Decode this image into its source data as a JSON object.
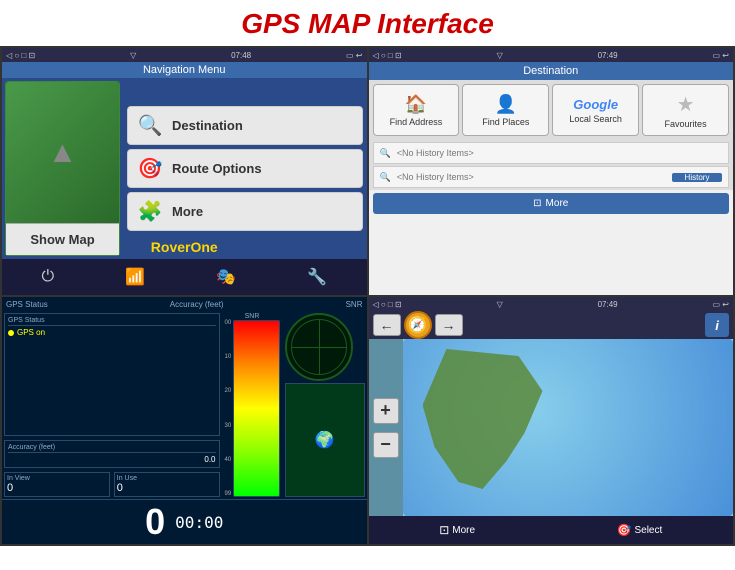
{
  "page": {
    "title": "GPS MAP Interface"
  },
  "screen1": {
    "title": "Navigation Menu",
    "status_bar": {
      "time": "07:48",
      "left_icons": "◁ ○ □ ⊡",
      "right_icons": "▽ 07:48 ▭ ↩"
    },
    "menu_items": [
      {
        "label": "Destination",
        "icon": "🔍"
      },
      {
        "label": "Route Options",
        "icon": "🎯"
      },
      {
        "label": "More",
        "icon": "🧩"
      }
    ],
    "show_map_label": "Show Map",
    "bottom_icons": [
      "⏻",
      "📶",
      "🎭",
      "🔧"
    ]
  },
  "screen2": {
    "title": "Destination",
    "status_bar": {
      "time": "07:49"
    },
    "buttons": [
      {
        "label": "Find Address",
        "icon": "🏠",
        "type": "address"
      },
      {
        "label": "Find Places",
        "icon": "👤",
        "type": "places"
      },
      {
        "label": "Local Search",
        "icon": "Google",
        "type": "google"
      },
      {
        "label": "Favourites",
        "icon": "★",
        "type": "fav"
      }
    ],
    "history_items": [
      {
        "text": "<No History Items>",
        "side": ""
      },
      {
        "text": "<No History Items>",
        "side": "History"
      }
    ],
    "more_label": "More",
    "more_icon": "⊡"
  },
  "screen3": {
    "status_bar": {
      "time": "GPS Status"
    },
    "gps_status": "GPS on",
    "accuracy_label": "Accuracy (feet)",
    "accuracy_value": "0.0",
    "snr_label": "SNR",
    "snr_numbers": [
      "00",
      "10",
      "20",
      "30",
      "40",
      "99"
    ],
    "in_view_label": "In View",
    "in_use_label": "In Use",
    "in_view_value": "0",
    "in_use_value": "0",
    "speed_value": "0",
    "time_value": "00:00"
  },
  "screen4": {
    "status_bar": {
      "time": "07:49"
    },
    "nav_buttons": [
      "←",
      "↑",
      "→"
    ],
    "compass_icon": "🧭",
    "info_icon": "i",
    "zoom_in": "+",
    "zoom_out": "−",
    "bottom_buttons": [
      {
        "label": "More",
        "icon": "⊡"
      },
      {
        "label": "Select",
        "icon": "🎯"
      }
    ]
  },
  "watermark": "RoverOne",
  "colors": {
    "title_red": "#cc0000",
    "nav_blue": "#2a4a8a",
    "gps_dark": "#001a33",
    "accent_yellow": "#FFD700"
  }
}
